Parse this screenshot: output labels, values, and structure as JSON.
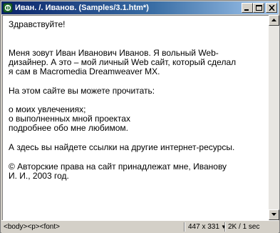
{
  "window": {
    "title": "Иван. /. Иванов. (Samples/3.1.htm*)",
    "icon": "dreamweaver-document-icon"
  },
  "document": {
    "greeting": "Здравствуйте!",
    "intro": "Меня зовут Иван Иванович Иванов. Я вольный Web-\nдизайнер. А это – мой личный Web сайт, который сделал\nя сам в Macromedia Dreamweaver MX.",
    "read_heading": "На этом сайте вы можете прочитать:",
    "list": [
      "о моих увлечениях;",
      "о выполненных мной проектах",
      "подробнее обо мне любимом."
    ],
    "links": "А здесь вы найдете ссылки на другие интернет-ресурсы.",
    "copyright": "© Авторские права на сайт принадлежат мне, Иванову\nИ. И., 2003 год."
  },
  "statusbar": {
    "tags": "<body><p><font>",
    "window_size": "447 x 331",
    "download": "2K / 1 sec"
  }
}
